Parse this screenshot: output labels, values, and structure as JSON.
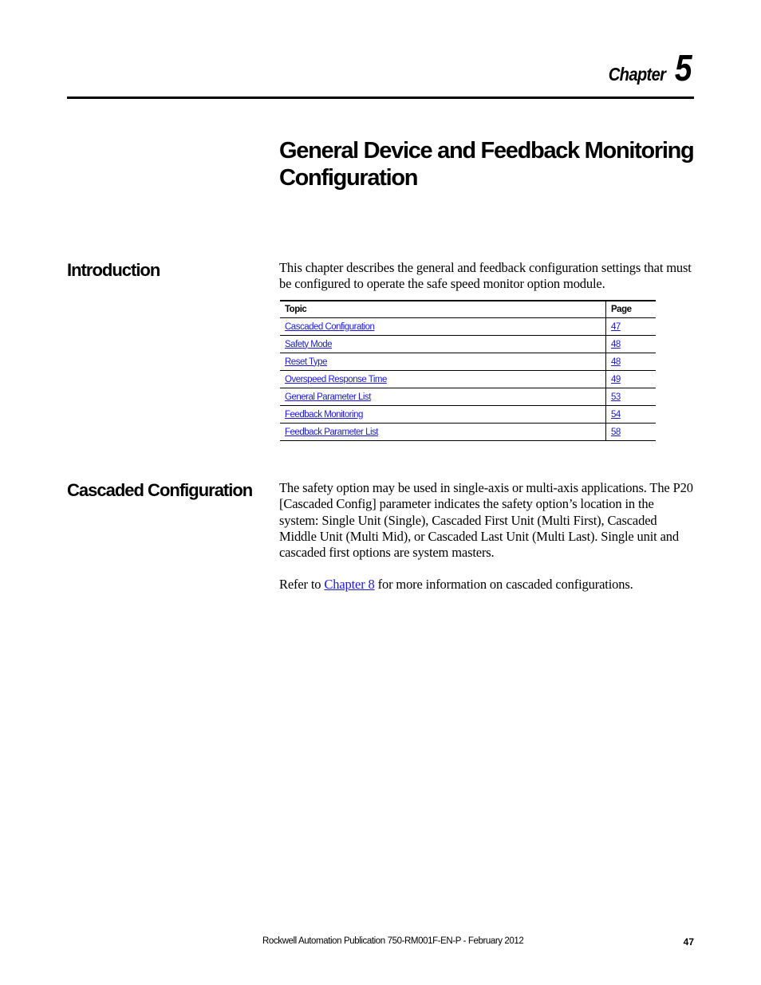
{
  "header": {
    "chapter_label": "Chapter",
    "chapter_number": "5"
  },
  "title": "General Device and Feedback Monitoring Configuration",
  "sections": {
    "introduction": {
      "heading": "Introduction",
      "paragraph": "This chapter describes the general and feedback configuration settings that must be configured to operate the safe speed monitor option module.",
      "table": {
        "headers": {
          "topic": "Topic",
          "page": "Page"
        },
        "rows": [
          {
            "topic": "Cascaded Configuration",
            "page": "47"
          },
          {
            "topic": "Safety Mode",
            "page": "48"
          },
          {
            "topic": "Reset Type",
            "page": "48"
          },
          {
            "topic": "Overspeed Response Time",
            "page": "49"
          },
          {
            "topic": "General Parameter List",
            "page": "53"
          },
          {
            "topic": "Feedback Monitoring",
            "page": "54"
          },
          {
            "topic": "Feedback Parameter List",
            "page": "58"
          }
        ]
      }
    },
    "cascaded": {
      "heading": "Cascaded Configuration",
      "paragraph": "The safety option may be used in single-axis or multi-axis applications. The P20 [Cascaded Config] parameter indicates the safety option’s location in the system: Single Unit (Single), Cascaded First Unit (Multi First), Cascaded Middle Unit (Multi Mid), or Cascaded Last Unit (Multi Last). Single unit and cascaded first options are system masters.",
      "refer": {
        "before": "Refer to ",
        "link_text": "Chapter 8",
        "after": " for more information on cascaded configurations."
      }
    }
  },
  "footer": {
    "publication": "Rockwell Automation Publication 750-RM001F-EN-P - February 2012",
    "page_number": "47"
  },
  "colors": {
    "link": "#1a1ad6",
    "text": "#000000",
    "background": "#ffffff"
  }
}
